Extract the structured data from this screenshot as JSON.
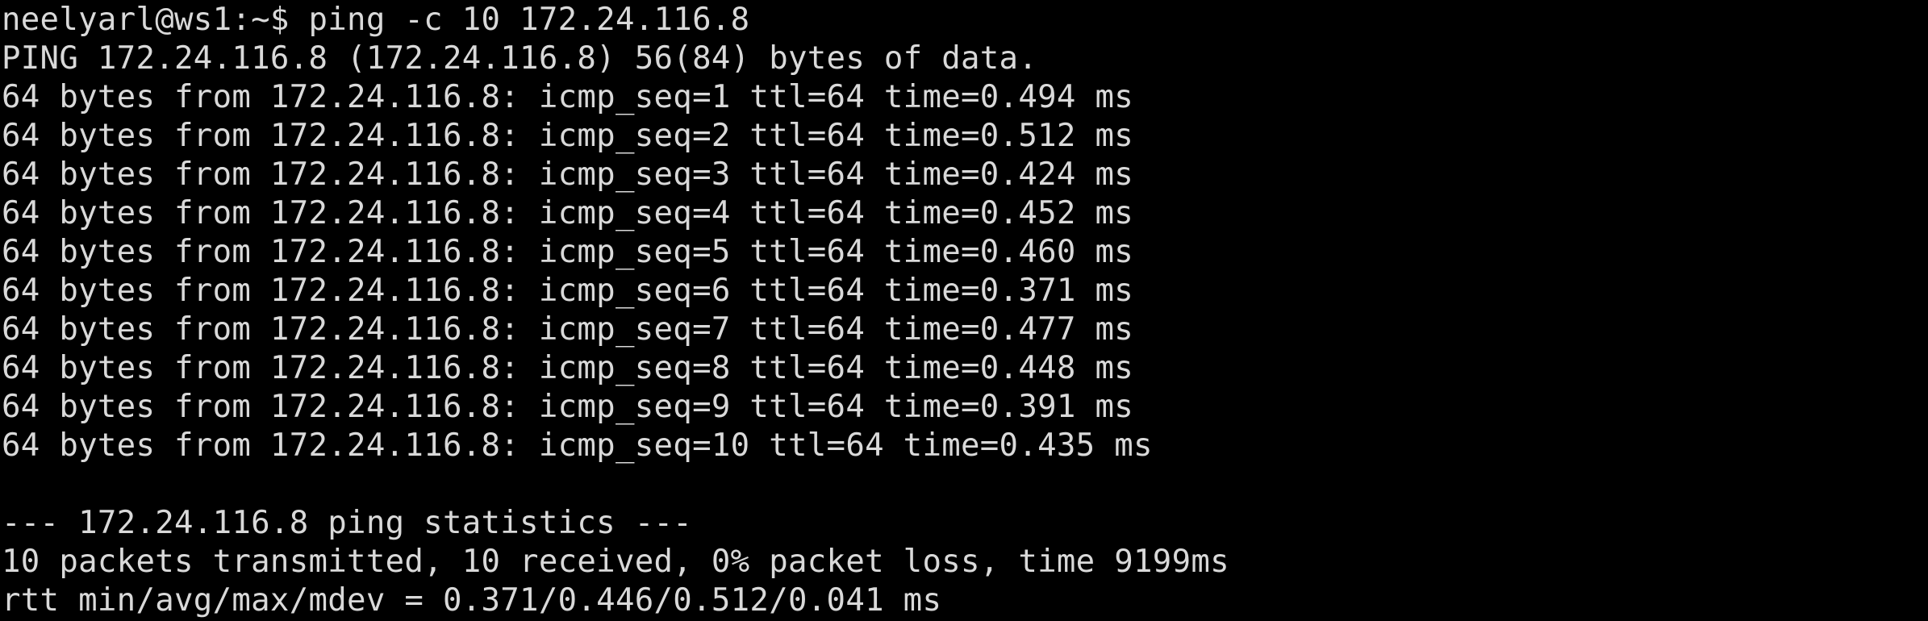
{
  "terminal": {
    "prompt": "neelyarl@ws1:~$ ",
    "command": "ping -c 10 172.24.116.8",
    "lines": [
      "PING 172.24.116.8 (172.24.116.8) 56(84) bytes of data.",
      "64 bytes from 172.24.116.8: icmp_seq=1 ttl=64 time=0.494 ms",
      "64 bytes from 172.24.116.8: icmp_seq=2 ttl=64 time=0.512 ms",
      "64 bytes from 172.24.116.8: icmp_seq=3 ttl=64 time=0.424 ms",
      "64 bytes from 172.24.116.8: icmp_seq=4 ttl=64 time=0.452 ms",
      "64 bytes from 172.24.116.8: icmp_seq=5 ttl=64 time=0.460 ms",
      "64 bytes from 172.24.116.8: icmp_seq=6 ttl=64 time=0.371 ms",
      "64 bytes from 172.24.116.8: icmp_seq=7 ttl=64 time=0.477 ms",
      "64 bytes from 172.24.116.8: icmp_seq=8 ttl=64 time=0.448 ms",
      "64 bytes from 172.24.116.8: icmp_seq=9 ttl=64 time=0.391 ms",
      "64 bytes from 172.24.116.8: icmp_seq=10 ttl=64 time=0.435 ms",
      "",
      "--- 172.24.116.8 ping statistics ---",
      "10 packets transmitted, 10 received, 0% packet loss, time 9199ms",
      "rtt min/avg/max/mdev = 0.371/0.446/0.512/0.041 ms"
    ]
  },
  "colors": {
    "background": "#000000",
    "foreground": "#d9d9d9"
  }
}
